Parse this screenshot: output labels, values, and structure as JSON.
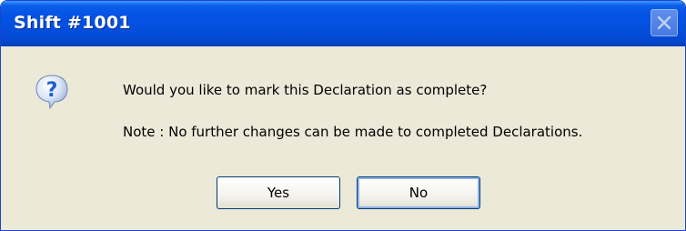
{
  "window": {
    "title": "Shift #1001"
  },
  "icon": {
    "name": "question-icon",
    "glyph": "?",
    "color": "#1c5fd0"
  },
  "message": {
    "main": "Would you like to mark this Declaration as complete?",
    "note": "Note : No further changes can be made to completed Declarations."
  },
  "buttons": {
    "yes_label": "Yes",
    "no_label": "No"
  },
  "colors": {
    "titlebar": "#0553e6",
    "dialog_background": "#ece9d8",
    "button_border": "#003c74"
  }
}
